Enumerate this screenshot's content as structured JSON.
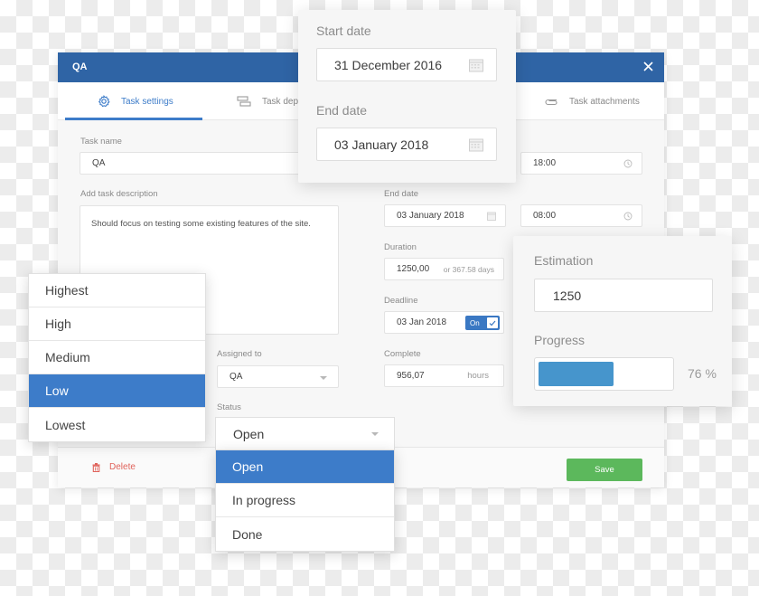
{
  "modal": {
    "title": "QA",
    "close_icon": "close-icon",
    "tabs": [
      {
        "label": "Task settings",
        "icon": "gear-icon",
        "active": true
      },
      {
        "label": "Task dep",
        "icon": "dependencies-icon",
        "active": false
      },
      {
        "label": "Task attachments",
        "icon": "paperclip-icon",
        "active": false
      }
    ],
    "task_name": {
      "label": "Task name",
      "value": "QA"
    },
    "description": {
      "label": "Add task description",
      "value": "Should focus on testing some existing features of the site."
    },
    "start_time": {
      "value": "18:00",
      "icon": "clock-icon"
    },
    "end_date": {
      "label": "End date",
      "value": "03 January 2018",
      "icon": "calendar-icon"
    },
    "end_time": {
      "value": "08:00",
      "icon": "clock-icon"
    },
    "duration": {
      "label": "Duration",
      "value": "1250,00",
      "hint": "or 367.58 days"
    },
    "deadline": {
      "label": "Deadline",
      "value": "03 Jan 2018",
      "toggle_label": "On",
      "toggle_on": true
    },
    "complete": {
      "label": "Complete",
      "value": "956,07",
      "unit": "hours"
    },
    "assigned_to": {
      "label": "Assigned to",
      "value": "QA"
    },
    "status": {
      "label": "Status"
    },
    "footer": {
      "delete_label": "Delete",
      "delete_icon": "trash-icon",
      "save_label": "Save"
    }
  },
  "dates_panel": {
    "start_label": "Start date",
    "start_value": "31 December 2016",
    "end_label": "End date",
    "end_value": "03 January 2018"
  },
  "estimation_panel": {
    "estimation_label": "Estimation",
    "estimation_value": "1250",
    "progress_label": "Progress",
    "progress_percent": 76,
    "progress_text": "76 %"
  },
  "priority_dropdown": {
    "options": [
      "Highest",
      "High",
      "Medium",
      "Low",
      "Lowest"
    ],
    "selected": "Low"
  },
  "status_dropdown": {
    "current": "Open",
    "options": [
      "Open",
      "In progress",
      "Done"
    ],
    "selected": "Open"
  },
  "colors": {
    "header_blue": "#2f64a5",
    "accent_blue": "#3d7cc9",
    "progress_blue": "#4695cc",
    "save_green": "#5cb85c",
    "delete_red": "#e0625a"
  }
}
